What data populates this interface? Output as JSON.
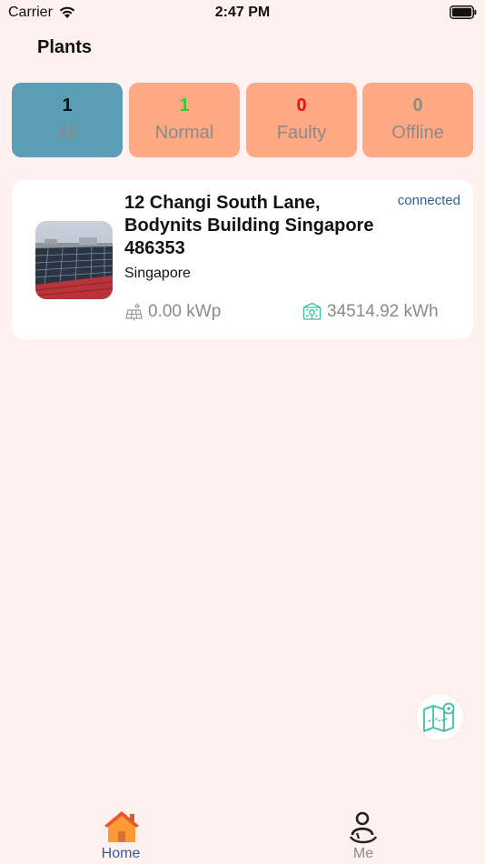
{
  "status_bar": {
    "carrier": "Carrier",
    "time": "2:47 PM"
  },
  "header": {
    "title": "Plants"
  },
  "filters": [
    {
      "count": "1",
      "label": "All",
      "count_color": "#111111",
      "bg": "#5b9eb5"
    },
    {
      "count": "1",
      "label": "Normal",
      "count_color": "#33cc33",
      "bg": "#fea983"
    },
    {
      "count": "0",
      "label": "Faulty",
      "count_color": "#ee1111",
      "bg": "#fea983"
    },
    {
      "count": "0",
      "label": "Offline",
      "count_color": "#8a8a8a",
      "bg": "#fea983"
    }
  ],
  "plants": [
    {
      "name": "12 Changi South Lane, Bodynits Building Singapore 486353",
      "status": "connected",
      "location": "Singapore",
      "capacity": "0.00 kWp",
      "energy": "34514.92 kWh",
      "thumb_icon": "solar-rooftop-photo"
    }
  ],
  "tab_bar": {
    "items": [
      {
        "label": "Home",
        "icon": "home-icon",
        "active": true
      },
      {
        "label": "Me",
        "icon": "user-icon",
        "active": false
      }
    ]
  },
  "colors": {
    "background": "#fef1f0",
    "active_tab": "#5b9eb5",
    "inactive_tab": "#fea983",
    "accent": "#2e5f99",
    "teal_icon": "#3dbfa0"
  }
}
